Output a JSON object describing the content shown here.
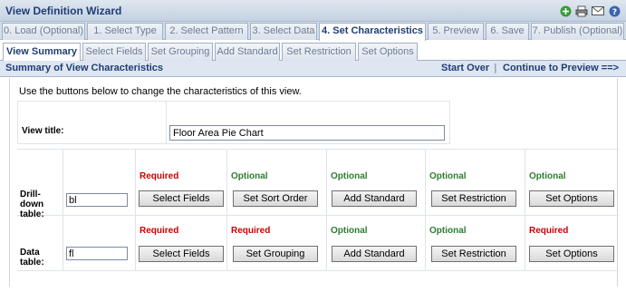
{
  "window": {
    "title": "View Definition Wizard",
    "icons": [
      "add-icon",
      "print-icon",
      "email-icon",
      "help-icon"
    ]
  },
  "steps": [
    {
      "label": "0. Load (Optional)"
    },
    {
      "label": "1. Select Type"
    },
    {
      "label": "2. Select Pattern"
    },
    {
      "label": "3. Select Data"
    },
    {
      "label": "4. Set Characteristics"
    },
    {
      "label": "5. Preview"
    },
    {
      "label": "6. Save"
    },
    {
      "label": "7. Publish (Optional)"
    }
  ],
  "subtabs": [
    {
      "label": "View Summary"
    },
    {
      "label": "Select Fields"
    },
    {
      "label": "Set Grouping"
    },
    {
      "label": "Add Standard"
    },
    {
      "label": "Set Restriction"
    },
    {
      "label": "Set Options"
    }
  ],
  "summary": {
    "title": "Summary of View Characteristics",
    "start_over": "Start Over",
    "separator": "|",
    "continue": "Continue to Preview ==>"
  },
  "instructions": "Use the buttons below to change the characteristics of this view.",
  "view_title": {
    "label": "View title:",
    "value": "Floor Area Pie Chart"
  },
  "drilldown": {
    "label_line1": "Drill-",
    "label_line2": "down",
    "label_line3": "table:",
    "table_value": "bl",
    "status": [
      "Required",
      "Optional",
      "Optional",
      "Optional",
      "Optional"
    ],
    "buttons": [
      "Select Fields",
      "Set Sort Order",
      "Add Standard",
      "Set Restriction",
      "Set Options"
    ]
  },
  "data_table": {
    "label_line1": "Data",
    "label_line2": "table:",
    "table_value": "fl",
    "status": [
      "Required",
      "Required",
      "Optional",
      "Optional",
      "Required"
    ],
    "buttons": [
      "Select Fields",
      "Set Grouping",
      "Add Standard",
      "Set Restriction",
      "Set Options"
    ]
  },
  "colors": {
    "required": "#cc0000",
    "optional": "#2e7d32",
    "header_text": "#1f3d74"
  }
}
